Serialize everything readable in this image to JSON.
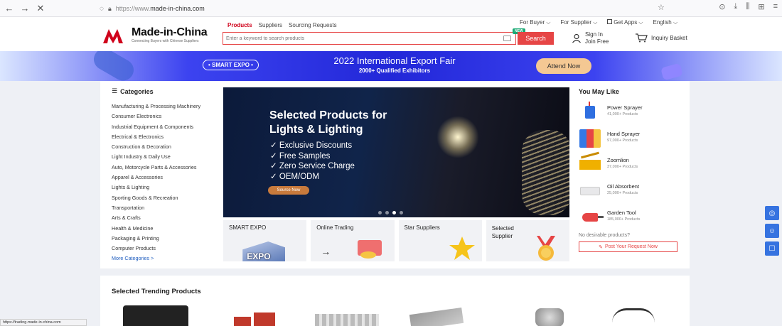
{
  "browser": {
    "url_prefix": "https://www.",
    "url_domain": "made-in-china.com",
    "back_icon": "back-arrow-icon",
    "forward_icon": "forward-arrow-icon",
    "close_icon": "close-icon"
  },
  "header": {
    "logo_text": "Made-in-China",
    "logo_sub": "Connecting Buyers with Chinese Suppliers",
    "search_tabs": [
      "Products",
      "Suppliers",
      "Sourcing Requests"
    ],
    "search_placeholder": "Enter a keyword to search products",
    "search_button": "Search",
    "new_badge": "NEW",
    "top_links": [
      "For Buyer ⌵",
      "For Supplier ⌵",
      "Get Apps ⌵",
      "English ⌵"
    ],
    "sign_in": "Sign In",
    "join_free": "Join Free",
    "inquiry_basket": "Inquiry Basket"
  },
  "banner": {
    "pill": "• SMART EXPO •",
    "title": "2022 International Export Fair",
    "subtitle": "2000+ Qualified Exhibitors",
    "button": "Attend Now"
  },
  "categories": {
    "title": "Categories",
    "items": [
      "Manufacturing & Processing Machinery",
      "Consumer Electronics",
      "Industrial Equipment & Components",
      "Electrical & Electronics",
      "Construction & Decoration",
      "Light Industry & Daily Use",
      "Auto, Motorcycle Parts & Accessories",
      "Apparel & Accessories",
      "Lights & Lighting",
      "Sporting Goods & Recreation",
      "Transportation",
      "Arts & Crafts",
      "Health & Medicine",
      "Packaging & Printing",
      "Computer Products"
    ],
    "more": "More Categories >"
  },
  "hero": {
    "title_line1": "Selected Products for",
    "title_line2": "Lights & Lighting",
    "bullets": [
      "✓  Exclusive Discounts",
      "✓  Free Samples",
      "✓  Zero Service Charge",
      "✓  OEM/ODM"
    ],
    "button": "Source Now",
    "active_slide": 2,
    "slide_count": 4
  },
  "tiles": [
    {
      "label": "SMART EXPO",
      "art": "EXPO"
    },
    {
      "label": "Online Trading",
      "art": "→"
    },
    {
      "label": "Star Suppliers",
      "art": ""
    },
    {
      "label": "Selected Supplier",
      "art": ""
    }
  ],
  "you_may_like": {
    "title": "You May Like",
    "items": [
      {
        "name": "Power Sprayer",
        "count": "41,000+ Products"
      },
      {
        "name": "Hand Sprayer",
        "count": "97,000+ Products"
      },
      {
        "name": "Zoomlion",
        "count": "37,000+ Products"
      },
      {
        "name": "Oil Absorbent",
        "count": "25,000+ Products"
      },
      {
        "name": "Garden Tool",
        "count": "185,000+ Products"
      }
    ],
    "no_desirable": "No desirable products?",
    "post_request": "Post Your Request Now"
  },
  "trending": {
    "title": "Selected Trending Products"
  },
  "status_bar": "https://trading.made-in-china.com",
  "colors": {
    "brand_red": "#e64545",
    "banner_blue": "#2227d8",
    "attend_orange": "#f4c893",
    "side_blue": "#3673e0"
  }
}
